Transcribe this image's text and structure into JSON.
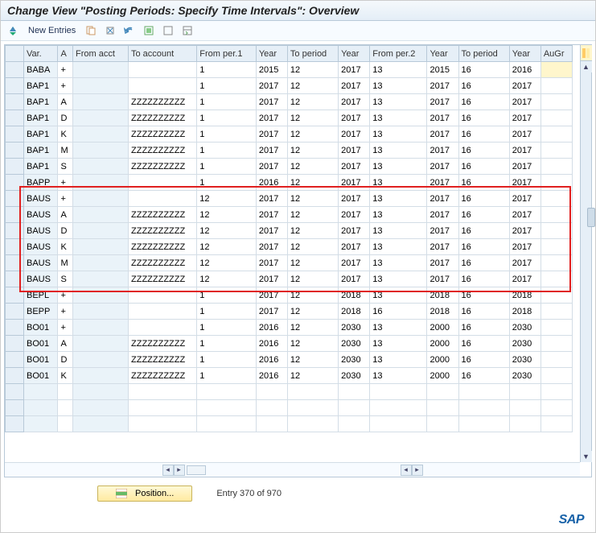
{
  "title": "Change View \"Posting Periods: Specify Time Intervals\": Overview",
  "toolbar": {
    "new_entries_label": "New Entries"
  },
  "columns": {
    "var": "Var.",
    "a": "A",
    "from_acct": "From acct",
    "to_account": "To account",
    "from_per1": "From per.1",
    "year1": "Year",
    "to_period1": "To period",
    "year2": "Year",
    "from_per2": "From per.2",
    "year3": "Year",
    "to_period2": "To period",
    "year4": "Year",
    "augr": "AuGr"
  },
  "rows": [
    {
      "var": "BABA",
      "a": "+",
      "from_acct": "",
      "to_acct": "",
      "fp1": "1",
      "y1": "2015",
      "tp1": "12",
      "y2": "2017",
      "fp2": "13",
      "y3": "2015",
      "tp2": "16",
      "y4": "2016",
      "augr": "",
      "augr_hl": true
    },
    {
      "var": "BAP1",
      "a": "+",
      "from_acct": "",
      "to_acct": "",
      "fp1": "1",
      "y1": "2017",
      "tp1": "12",
      "y2": "2017",
      "fp2": "13",
      "y3": "2017",
      "tp2": "16",
      "y4": "2017",
      "augr": ""
    },
    {
      "var": "BAP1",
      "a": "A",
      "from_acct": "",
      "to_acct": "ZZZZZZZZZZ",
      "fp1": "1",
      "y1": "2017",
      "tp1": "12",
      "y2": "2017",
      "fp2": "13",
      "y3": "2017",
      "tp2": "16",
      "y4": "2017",
      "augr": ""
    },
    {
      "var": "BAP1",
      "a": "D",
      "from_acct": "",
      "to_acct": "ZZZZZZZZZZ",
      "fp1": "1",
      "y1": "2017",
      "tp1": "12",
      "y2": "2017",
      "fp2": "13",
      "y3": "2017",
      "tp2": "16",
      "y4": "2017",
      "augr": ""
    },
    {
      "var": "BAP1",
      "a": "K",
      "from_acct": "",
      "to_acct": "ZZZZZZZZZZ",
      "fp1": "1",
      "y1": "2017",
      "tp1": "12",
      "y2": "2017",
      "fp2": "13",
      "y3": "2017",
      "tp2": "16",
      "y4": "2017",
      "augr": ""
    },
    {
      "var": "BAP1",
      "a": "M",
      "from_acct": "",
      "to_acct": "ZZZZZZZZZZ",
      "fp1": "1",
      "y1": "2017",
      "tp1": "12",
      "y2": "2017",
      "fp2": "13",
      "y3": "2017",
      "tp2": "16",
      "y4": "2017",
      "augr": ""
    },
    {
      "var": "BAP1",
      "a": "S",
      "from_acct": "",
      "to_acct": "ZZZZZZZZZZ",
      "fp1": "1",
      "y1": "2017",
      "tp1": "12",
      "y2": "2017",
      "fp2": "13",
      "y3": "2017",
      "tp2": "16",
      "y4": "2017",
      "augr": ""
    },
    {
      "var": "BAPP",
      "a": "+",
      "from_acct": "",
      "to_acct": "",
      "fp1": "1",
      "y1": "2016",
      "tp1": "12",
      "y2": "2017",
      "fp2": "13",
      "y3": "2017",
      "tp2": "16",
      "y4": "2017",
      "augr": ""
    },
    {
      "var": "BAUS",
      "a": "+",
      "from_acct": "",
      "to_acct": "",
      "fp1": "12",
      "y1": "2017",
      "tp1": "12",
      "y2": "2017",
      "fp2": "13",
      "y3": "2017",
      "tp2": "16",
      "y4": "2017",
      "augr": ""
    },
    {
      "var": "BAUS",
      "a": "A",
      "from_acct": "",
      "to_acct": "ZZZZZZZZZZ",
      "fp1": "12",
      "y1": "2017",
      "tp1": "12",
      "y2": "2017",
      "fp2": "13",
      "y3": "2017",
      "tp2": "16",
      "y4": "2017",
      "augr": ""
    },
    {
      "var": "BAUS",
      "a": "D",
      "from_acct": "",
      "to_acct": "ZZZZZZZZZZ",
      "fp1": "12",
      "y1": "2017",
      "tp1": "12",
      "y2": "2017",
      "fp2": "13",
      "y3": "2017",
      "tp2": "16",
      "y4": "2017",
      "augr": ""
    },
    {
      "var": "BAUS",
      "a": "K",
      "from_acct": "",
      "to_acct": "ZZZZZZZZZZ",
      "fp1": "12",
      "y1": "2017",
      "tp1": "12",
      "y2": "2017",
      "fp2": "13",
      "y3": "2017",
      "tp2": "16",
      "y4": "2017",
      "augr": ""
    },
    {
      "var": "BAUS",
      "a": "M",
      "from_acct": "",
      "to_acct": "ZZZZZZZZZZ",
      "fp1": "12",
      "y1": "2017",
      "tp1": "12",
      "y2": "2017",
      "fp2": "13",
      "y3": "2017",
      "tp2": "16",
      "y4": "2017",
      "augr": ""
    },
    {
      "var": "BAUS",
      "a": "S",
      "from_acct": "",
      "to_acct": "ZZZZZZZZZZ",
      "fp1": "12",
      "y1": "2017",
      "tp1": "12",
      "y2": "2017",
      "fp2": "13",
      "y3": "2017",
      "tp2": "16",
      "y4": "2017",
      "augr": ""
    },
    {
      "var": "BEPL",
      "a": "+",
      "from_acct": "",
      "to_acct": "",
      "fp1": "1",
      "y1": "2017",
      "tp1": "12",
      "y2": "2018",
      "fp2": "13",
      "y3": "2018",
      "tp2": "16",
      "y4": "2018",
      "augr": ""
    },
    {
      "var": "BEPP",
      "a": "+",
      "from_acct": "",
      "to_acct": "",
      "fp1": "1",
      "y1": "2017",
      "tp1": "12",
      "y2": "2018",
      "fp2": "16",
      "y3": "2018",
      "tp2": "16",
      "y4": "2018",
      "augr": ""
    },
    {
      "var": "BO01",
      "a": "+",
      "from_acct": "",
      "to_acct": "",
      "fp1": "1",
      "y1": "2016",
      "tp1": "12",
      "y2": "2030",
      "fp2": "13",
      "y3": "2000",
      "tp2": "16",
      "y4": "2030",
      "augr": ""
    },
    {
      "var": "BO01",
      "a": "A",
      "from_acct": "",
      "to_acct": "ZZZZZZZZZZ",
      "fp1": "1",
      "y1": "2016",
      "tp1": "12",
      "y2": "2030",
      "fp2": "13",
      "y3": "2000",
      "tp2": "16",
      "y4": "2030",
      "augr": ""
    },
    {
      "var": "BO01",
      "a": "D",
      "from_acct": "",
      "to_acct": "ZZZZZZZZZZ",
      "fp1": "1",
      "y1": "2016",
      "tp1": "12",
      "y2": "2030",
      "fp2": "13",
      "y3": "2000",
      "tp2": "16",
      "y4": "2030",
      "augr": ""
    },
    {
      "var": "BO01",
      "a": "K",
      "from_acct": "",
      "to_acct": "ZZZZZZZZZZ",
      "fp1": "1",
      "y1": "2016",
      "tp1": "12",
      "y2": "2030",
      "fp2": "13",
      "y3": "2000",
      "tp2": "16",
      "y4": "2030",
      "augr": ""
    }
  ],
  "footer": {
    "position_label": "Position...",
    "entry_text": "Entry 370 of 970"
  },
  "brand": "SAP"
}
